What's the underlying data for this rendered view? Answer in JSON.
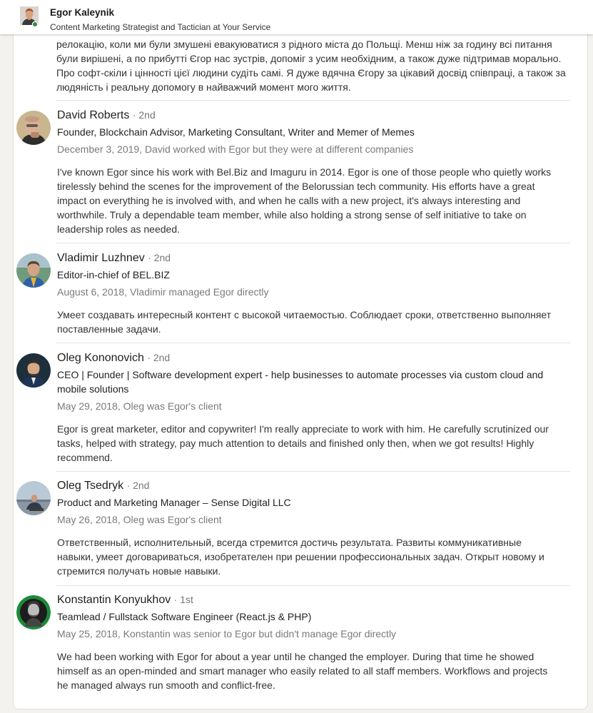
{
  "profile": {
    "name": "Egor Kaleynik",
    "headline": "Content Marketing Strategist and Tactician at Your Service"
  },
  "partial_text": "релокацію, коли ми були змушені евакуюватися з рідного міста до Польщі. Менш ніж за годину всі питання були вирішені, а по прибутті Єгор нас зустрів, допоміг з усим необхідним, а також дуже підтримав морально. Про софт-скіли і цінності цієї людини судіть самі. Я дуже вдячна Єгору за цікавий досвід співпраці, а також за людяність і реальну допомогу в найважчий момент мого життя.",
  "recommendations": [
    {
      "name": "David Roberts",
      "degree": "· 2nd",
      "title": "Founder, Blockchain Advisor, Marketing Consultant, Writer and Memer of Memes",
      "relationship": "December 3, 2019, David worked with Egor but they were at different companies",
      "text": "I've known Egor since his work with Bel.Biz and Imaguru in 2014. Egor is one of those people who quietly works tirelessly behind the scenes for the improvement of the Belorussian tech community. His efforts have a great impact on everything he is involved with, and when he calls with a new project, it's always interesting and worthwhile. Truly a dependable team member, while also holding a strong sense of self initiative to take on leadership roles as needed."
    },
    {
      "name": "Vladimir Luzhnev",
      "degree": "· 2nd",
      "title": "Editor-in-chief of BEL.BIZ",
      "relationship": "August 6, 2018, Vladimir managed Egor directly",
      "text": "Умеет создавать интересный контент с высокой читаемостью. Соблюдает сроки, ответственно выполняет поставленные задачи."
    },
    {
      "name": "Oleg Kononovich",
      "degree": "· 2nd",
      "title": "CEO | Founder | Software development expert - help businesses to automate processes via custom cloud and mobile solutions",
      "relationship": "May 29, 2018, Oleg was Egor's client",
      "text": "Egor is great marketer, editor and copywriter! I'm really appreciate to work with him. He carefully scrutinized our tasks, helped with strategy, pay much attention to details and finished only then, when we got results! Highly recommend."
    },
    {
      "name": "Oleg Tsedryk",
      "degree": "· 2nd",
      "title": "Product and Marketing Manager – Sense Digital LLC",
      "relationship": "May 26, 2018, Oleg was Egor's client",
      "text": "Ответственный, исполнительный, всегда стремится достичь результата. Развиты коммуникативные навыки, умеет договариваться, изобретателен при решении профессиональных задач. Открыт новому и стремится получать новые навыки."
    },
    {
      "name": "Konstantin Konyukhov",
      "degree": "· 1st",
      "title": "Teamlead / Fullstack Software Engineer (React.js & PHP)",
      "relationship": "May 25, 2018, Konstantin was senior to Egor but didn't manage Egor directly",
      "text": "We had been working with Egor for about a year until he changed the employer. During that time he showed himself as an open-minded and smart manager who easily related to all staff members. Workflows and projects he managed always run smooth and conflict-free."
    }
  ]
}
